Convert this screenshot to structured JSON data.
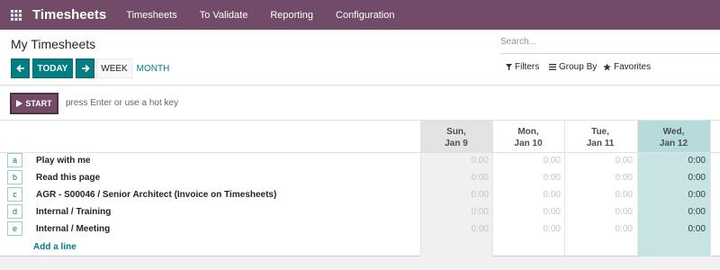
{
  "navbar": {
    "app_name": "Timesheets",
    "menu": [
      "Timesheets",
      "To Validate",
      "Reporting",
      "Configuration"
    ]
  },
  "control": {
    "title": "My Timesheets",
    "search_placeholder": "Search...",
    "today_label": "TODAY",
    "week_label": "WEEK",
    "month_label": "MONTH",
    "filters_label": "Filters",
    "group_by_label": "Group By",
    "favorites_label": "Favorites"
  },
  "start": {
    "button_label": "START",
    "hint": "press Enter or use a hot key"
  },
  "grid": {
    "days": [
      {
        "dow": "Sun,",
        "date": "Jan 9"
      },
      {
        "dow": "Mon,",
        "date": "Jan 10"
      },
      {
        "dow": "Tue,",
        "date": "Jan 11"
      },
      {
        "dow": "Wed,",
        "date": "Jan 12"
      }
    ],
    "rows": [
      {
        "hotkey": "a",
        "label": "Play with me",
        "values": [
          "0:00",
          "0:00",
          "0:00",
          "0:00"
        ]
      },
      {
        "hotkey": "b",
        "label": "Read this page",
        "values": [
          "0:00",
          "0:00",
          "0:00",
          "0:00"
        ]
      },
      {
        "hotkey": "c",
        "label": "AGR - S00046 / Senior Architect (Invoice on Timesheets)",
        "values": [
          "0:00",
          "0:00",
          "0:00",
          "0:00"
        ]
      },
      {
        "hotkey": "d",
        "label": "Internal / Training",
        "values": [
          "0:00",
          "0:00",
          "0:00",
          "0:00"
        ]
      },
      {
        "hotkey": "e",
        "label": "Internal / Meeting",
        "values": [
          "0:00",
          "0:00",
          "0:00",
          "0:00"
        ]
      }
    ],
    "add_line_label": "Add a line"
  },
  "colors": {
    "brand": "#714b67",
    "accent": "#017e84",
    "today_column": "#b7dadb"
  }
}
